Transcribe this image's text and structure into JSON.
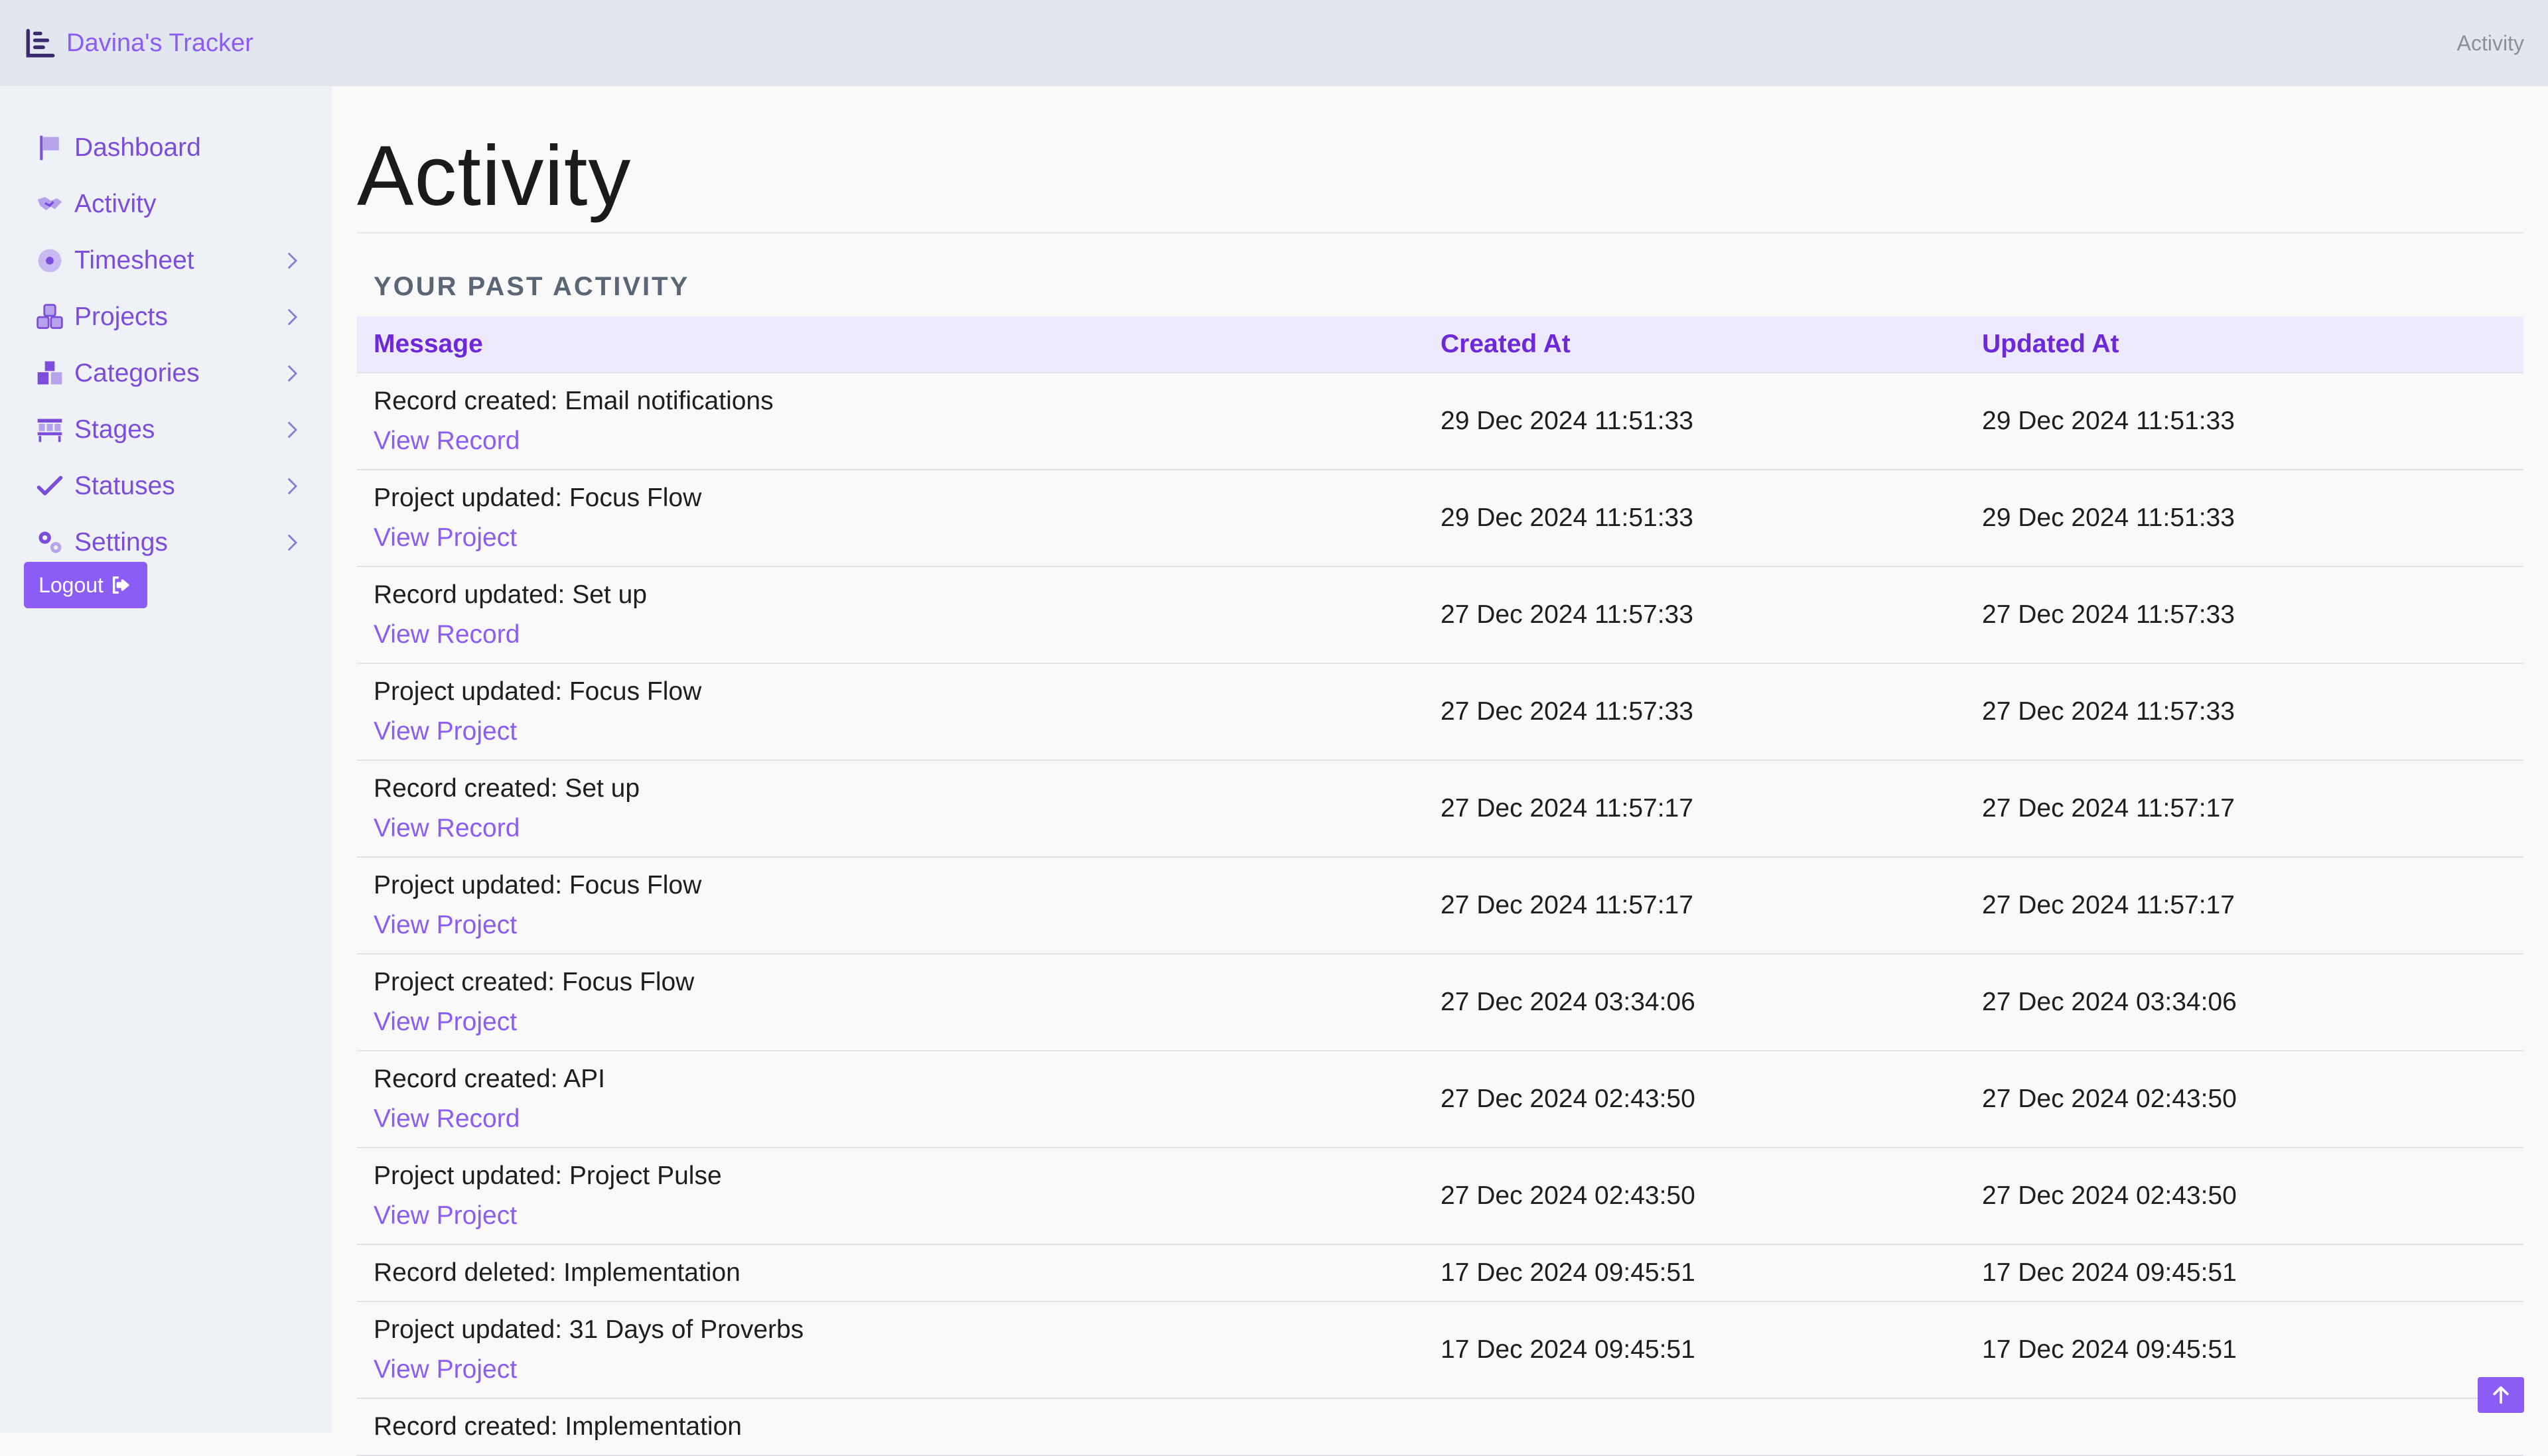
{
  "app": {
    "brand": "Davina's Tracker",
    "topbar_right": "Activity",
    "brand_icon": "chart-icon",
    "accent_color": "#8b5cf6"
  },
  "sidebar": {
    "items": [
      {
        "label": "Dashboard",
        "icon": "flag-icon",
        "has_chevron": false
      },
      {
        "label": "Activity",
        "icon": "handshake-icon",
        "has_chevron": false
      },
      {
        "label": "Timesheet",
        "icon": "disc-icon",
        "has_chevron": true
      },
      {
        "label": "Projects",
        "icon": "cubes-icon",
        "has_chevron": true
      },
      {
        "label": "Categories",
        "icon": "boxes-icon",
        "has_chevron": true
      },
      {
        "label": "Stages",
        "icon": "shelves-icon",
        "has_chevron": true
      },
      {
        "label": "Statuses",
        "icon": "check-icon",
        "has_chevron": true
      },
      {
        "label": "Settings",
        "icon": "gears-icon",
        "has_chevron": true
      }
    ],
    "logout_label": "Logout"
  },
  "main": {
    "title": "Activity",
    "section_title": "YOUR PAST ACTIVITY",
    "table": {
      "headers": {
        "message": "Message",
        "created_at": "Created At",
        "updated_at": "Updated At"
      },
      "rows": [
        {
          "message": "Record created: Email notifications",
          "link": "View Record",
          "created": "29 Dec 2024 11:51:33",
          "updated": "29 Dec 2024 11:51:33"
        },
        {
          "message": "Project updated: Focus Flow",
          "link": "View Project",
          "created": "29 Dec 2024 11:51:33",
          "updated": "29 Dec 2024 11:51:33"
        },
        {
          "message": "Record updated: Set up",
          "link": "View Record",
          "created": "27 Dec 2024 11:57:33",
          "updated": "27 Dec 2024 11:57:33"
        },
        {
          "message": "Project updated: Focus Flow",
          "link": "View Project",
          "created": "27 Dec 2024 11:57:33",
          "updated": "27 Dec 2024 11:57:33"
        },
        {
          "message": "Record created: Set up",
          "link": "View Record",
          "created": "27 Dec 2024 11:57:17",
          "updated": "27 Dec 2024 11:57:17"
        },
        {
          "message": "Project updated: Focus Flow",
          "link": "View Project",
          "created": "27 Dec 2024 11:57:17",
          "updated": "27 Dec 2024 11:57:17"
        },
        {
          "message": "Project created: Focus Flow",
          "link": "View Project",
          "created": "27 Dec 2024 03:34:06",
          "updated": "27 Dec 2024 03:34:06"
        },
        {
          "message": "Record created: API",
          "link": "View Record",
          "created": "27 Dec 2024 02:43:50",
          "updated": "27 Dec 2024 02:43:50"
        },
        {
          "message": "Project updated: Project Pulse",
          "link": "View Project",
          "created": "27 Dec 2024 02:43:50",
          "updated": "27 Dec 2024 02:43:50"
        },
        {
          "message": "Record deleted: Implementation",
          "link": "",
          "created": "17 Dec 2024 09:45:51",
          "updated": "17 Dec 2024 09:45:51"
        },
        {
          "message": "Project updated: 31 Days of Proverbs",
          "link": "View Project",
          "created": "17 Dec 2024 09:45:51",
          "updated": "17 Dec 2024 09:45:51"
        },
        {
          "message": "Record created: Implementation",
          "link": "",
          "created": "",
          "updated": ""
        }
      ]
    }
  }
}
